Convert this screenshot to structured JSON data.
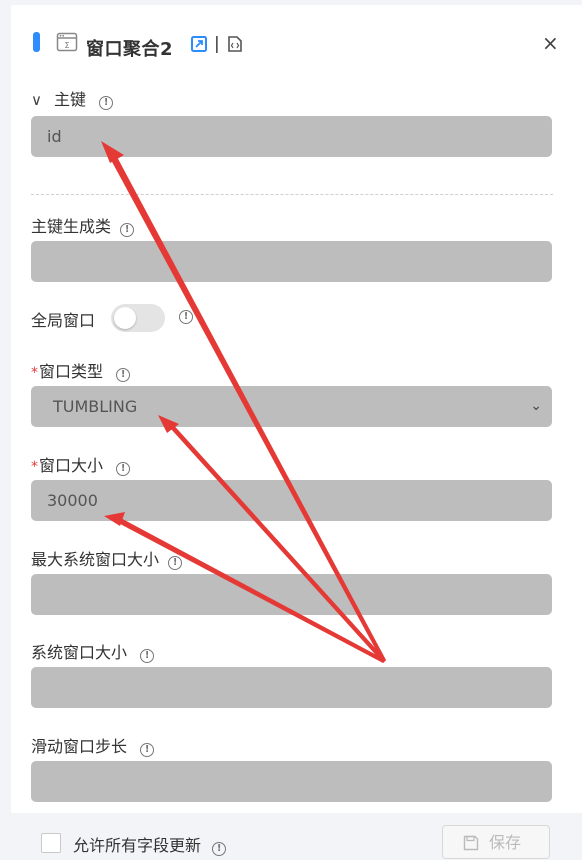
{
  "header": {
    "title": "窗口聚合2",
    "separator": "|",
    "close_glyph": "×",
    "icons": [
      "operator-icon",
      "reference-icon",
      "code-icon",
      "close-icon"
    ],
    "accent_color": "#2f8cff"
  },
  "sections": {
    "primary_key": {
      "label": "主键",
      "value": "id",
      "expanded": true,
      "chevron": "∨"
    }
  },
  "fields": {
    "key_generator": {
      "label": "主键生成类",
      "value": ""
    },
    "global_window": {
      "label": "全局窗口",
      "enabled": false
    },
    "window_type": {
      "label": "窗口类型",
      "required_mark": "*",
      "selected": "TUMBLING",
      "chevron": "⌄"
    },
    "window_size": {
      "label": "窗口大小",
      "required_mark": "*",
      "value": "30000"
    },
    "max_system_window": {
      "label": "最大系统窗口大小",
      "value": ""
    },
    "system_window_size": {
      "label": "系统窗口大小",
      "value": ""
    },
    "slide_step": {
      "label": "滑动窗口步长",
      "value": ""
    }
  },
  "footer": {
    "checkbox_label": "允许所有字段更新",
    "checked": false,
    "save_label": "保存"
  },
  "info_glyph": "!",
  "colors": {
    "field_background": "#bdbdbd",
    "required": "#e43b3b",
    "annotation_arrow": "#e53935"
  },
  "annotation": {
    "arrow_targets": [
      "id",
      "TUMBLING",
      "30000"
    ]
  }
}
